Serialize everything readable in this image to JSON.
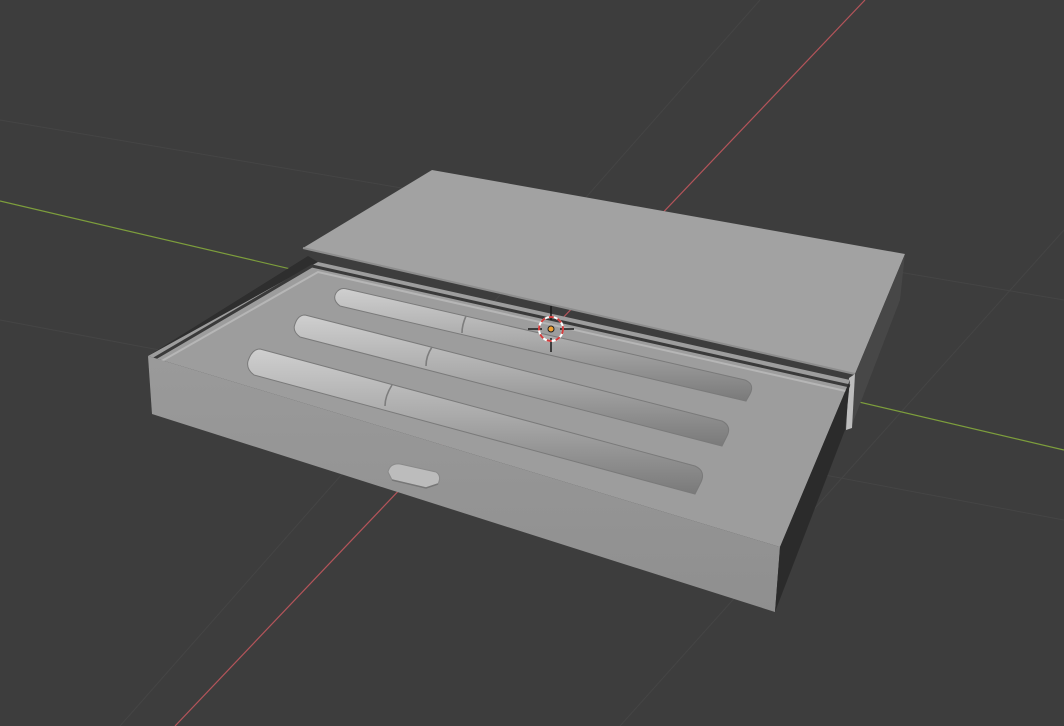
{
  "viewport": {
    "mode": "3D Viewport",
    "shading": "solid",
    "background_color": "#3d3d3d"
  },
  "axes": {
    "x_axis_color": "#b4545a",
    "y_axis_color": "#7d9e3c"
  },
  "scene": {
    "object": "pen-box",
    "contents": [
      "pen-1",
      "pen-2",
      "pen-3"
    ],
    "lid_state": "sliding-open",
    "tray_color": "#9d9d9d",
    "lid_color": "#a2a2a2"
  },
  "cursor": {
    "icon": "3d-cursor-icon",
    "ring_color": "#d23c3c",
    "origin_color": "#f0a030"
  }
}
